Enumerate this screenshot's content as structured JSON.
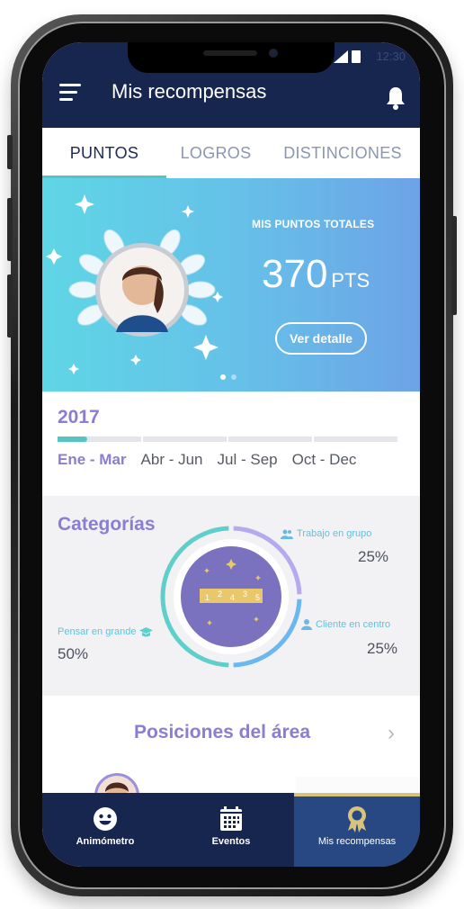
{
  "status_bar": {
    "time": "12:30"
  },
  "header": {
    "title": "Mis recompensas",
    "menu_icon": "menu-icon",
    "notification_icon": "bell-icon"
  },
  "tabs": [
    {
      "label": "PUNTOS",
      "active": true
    },
    {
      "label": "LOGROS",
      "active": false
    },
    {
      "label": "DISTINCIONES",
      "active": false
    }
  ],
  "banner": {
    "label": "MIS PUNTOS TOTALES",
    "points_value": "370",
    "points_unit": "PTS",
    "detail_button": "Ver detalle",
    "page_count": 2,
    "active_page": 1
  },
  "year": {
    "title": "2017",
    "quarters": [
      {
        "label": "Ene - Mar",
        "active": true,
        "progress": 0.35
      },
      {
        "label": "Abr - Jun",
        "active": false,
        "progress": 0
      },
      {
        "label": "Jul - Sep",
        "active": false,
        "progress": 0
      },
      {
        "label": "Oct - Dec",
        "active": false,
        "progress": 0
      }
    ]
  },
  "categories": {
    "title": "Categorías",
    "items": [
      {
        "label": "Trabajo en grupo",
        "percent": "25%",
        "value": 25,
        "icon": "group-icon",
        "color": "#b6a9ee"
      },
      {
        "label": "Cliente en centro",
        "percent": "25%",
        "value": 25,
        "icon": "person-icon",
        "color": "#6bb8f0"
      },
      {
        "label": "Pensar en grande",
        "percent": "50%",
        "value": 50,
        "icon": "graduation-cap-icon",
        "color": "#5fcfcc"
      }
    ],
    "center_ruler_labels": [
      "1",
      "2",
      "4",
      "3",
      "5"
    ]
  },
  "positions": {
    "title": "Posiciones del área"
  },
  "bottom_nav": [
    {
      "label": "Animómetro",
      "icon": "smiley-icon",
      "active": false
    },
    {
      "label": "Eventos",
      "icon": "calendar-icon",
      "active": false
    },
    {
      "label": "Mis recompensas",
      "icon": "award-ribbon-icon",
      "active": true
    }
  ],
  "colors": {
    "navy": "#17264f",
    "accent_teal": "#57c4c4",
    "accent_purple": "#8a7ed2",
    "active_nav": "#274883",
    "gold": "#d9c27a"
  }
}
